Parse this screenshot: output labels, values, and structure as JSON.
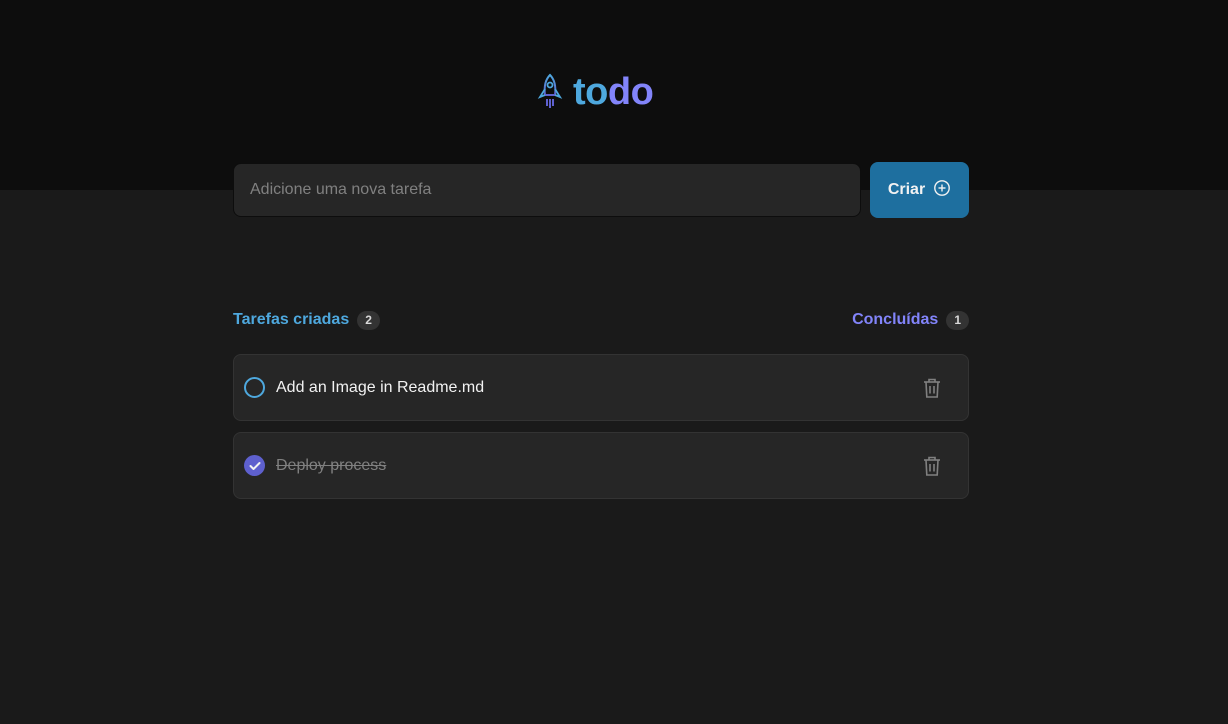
{
  "app": {
    "logo_part1": "to",
    "logo_part2": "do",
    "icon": "rocket-icon"
  },
  "form": {
    "placeholder": "Adicione uma nova tarefa",
    "value": "",
    "button_label": "Criar",
    "button_icon": "plus-circle-icon"
  },
  "counters": {
    "created_label": "Tarefas criadas",
    "created_count": "2",
    "done_label": "Concluídas",
    "done_count": "1"
  },
  "tasks": [
    {
      "text": "Add an Image in Readme.md",
      "completed": false
    },
    {
      "text": "Deploy process",
      "completed": true
    }
  ],
  "colors": {
    "blue": "#4ea8de",
    "purple": "#8284fa",
    "button": "#1e6f9f",
    "check": "#5e60ce"
  }
}
